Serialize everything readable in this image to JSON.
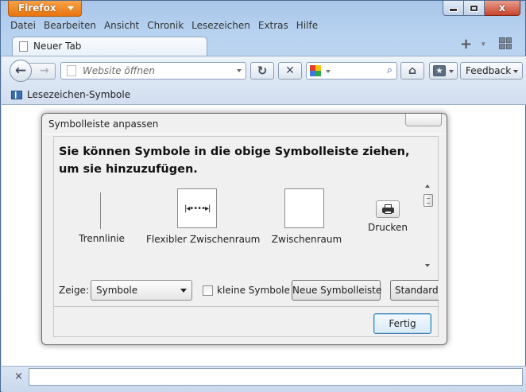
{
  "app_button": {
    "label": "Firefox"
  },
  "window_controls": {
    "close_glyph": "x"
  },
  "menu": [
    {
      "label": "Datei"
    },
    {
      "label": "Bearbeiten"
    },
    {
      "label": "Ansicht"
    },
    {
      "label": "Chronik"
    },
    {
      "label": "Lesezeichen"
    },
    {
      "label": "Extras"
    },
    {
      "label": "Hilfe"
    }
  ],
  "tabs": [
    {
      "label": "Neuer Tab"
    }
  ],
  "tabstrip": {
    "new_tab_glyph": "+",
    "list_glyph": "▾"
  },
  "navbar": {
    "back_glyph": "←",
    "forward_glyph": "→",
    "url_placeholder": "Website öffnen",
    "reload_glyph": "↻",
    "stop_glyph": "✕",
    "search_glyph": "⌕",
    "home_glyph": "⌂",
    "bookmarks_glyph": "★",
    "feedback_label": "Feedback"
  },
  "bookmarks_bar": {
    "item_label": "Lesezeichen-Symbole"
  },
  "findbar": {
    "close_glyph": "×",
    "value": ""
  },
  "dialog": {
    "title": "Symbolleiste anpassen",
    "heading": "Sie können Symbole in die obige Symbolleiste ziehen, um sie hinzuzufügen.",
    "palette": [
      {
        "label": "Trennlinie",
        "icon": "separator-icon"
      },
      {
        "label": "Flexibler Zwischenraum",
        "icon": "flexible-space-icon"
      },
      {
        "label": "Zwischenraum",
        "icon": "space-icon"
      },
      {
        "label": "Drucken",
        "icon": "print-icon"
      }
    ],
    "flex_glyph": "|◂••••▸|",
    "show_label": "Zeige:",
    "show_value": "Symbole",
    "small_icons_label": "kleine Symbole",
    "small_icons_checked": false,
    "new_toolbar_label": "Neue Symbolleiste",
    "default_label": "Standard wiederherstellen",
    "done_label": "Fertig"
  },
  "colors": {
    "app_button": "#e8740f",
    "window_frame": "#b7d2f0",
    "close_button": "#c8452d",
    "done_button_border": "#3c7fb1"
  }
}
